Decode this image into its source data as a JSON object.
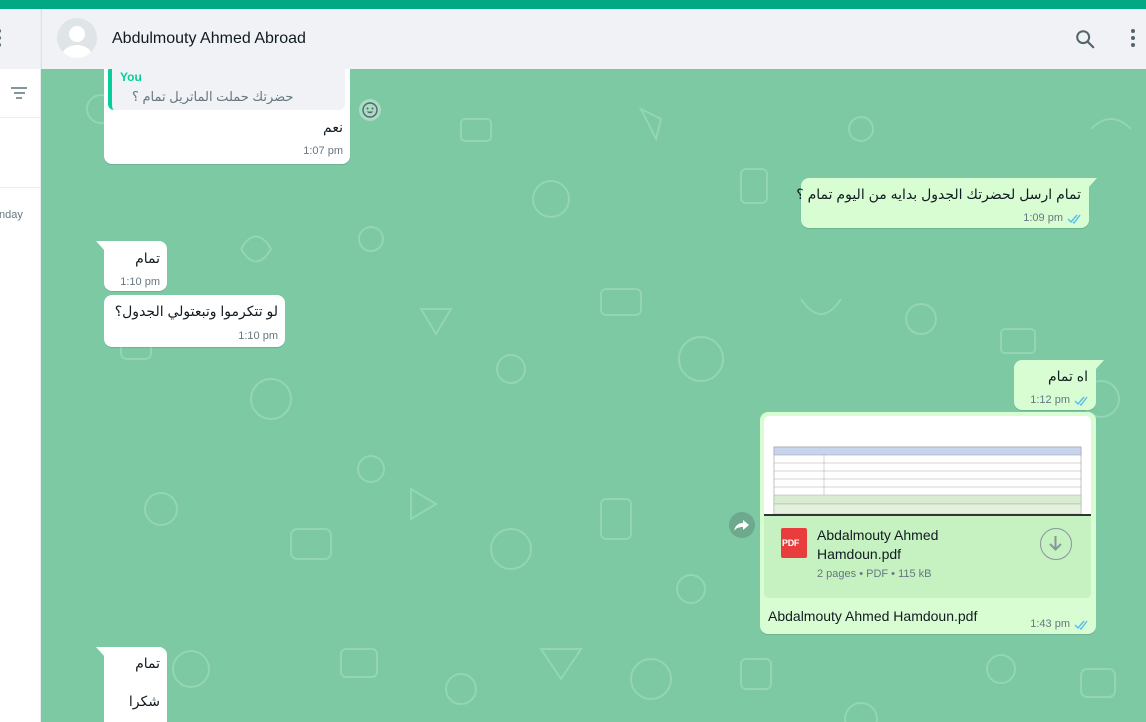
{
  "colors": {
    "accent": "#00a884",
    "chat_bg": "#7cc9a4",
    "outgoing": "#d9fdd3",
    "incoming": "#ffffff",
    "read_ticks": "#53bdeb"
  },
  "sidebar": {
    "day_label": "nday"
  },
  "header": {
    "contact_name": "Abdulmouty Ahmed Abroad"
  },
  "messages": [
    {
      "dir": "in",
      "quote": {
        "author": "You",
        "text": "حضرتك حملت الماتريل تمام ؟"
      },
      "text": "نعم",
      "time": "1:07 pm"
    },
    {
      "dir": "out",
      "text": "تمام ارسل لحضرتك الجدول بدايه من اليوم تمام ؟",
      "time": "1:09 pm"
    },
    {
      "dir": "in",
      "text": "تمام",
      "time": "1:10 pm"
    },
    {
      "dir": "in",
      "text": "لو تتكرموا وتبعتولي الجدول؟",
      "time": "1:10 pm"
    },
    {
      "dir": "out",
      "text": "اه تمام",
      "time": "1:12 pm"
    },
    {
      "dir": "out",
      "type": "document",
      "file_name": "Abdalmouty Ahmed Hamdoun.pdf",
      "pages": "2 pages",
      "file_type": "PDF",
      "size": "115 kB",
      "caption": "Abdalmouty Ahmed Hamdoun.pdf",
      "time": "1:43 pm",
      "icon_label": "PDF"
    },
    {
      "dir": "in",
      "text": "تمام"
    },
    {
      "dir": "in",
      "text": "شكرا"
    }
  ]
}
